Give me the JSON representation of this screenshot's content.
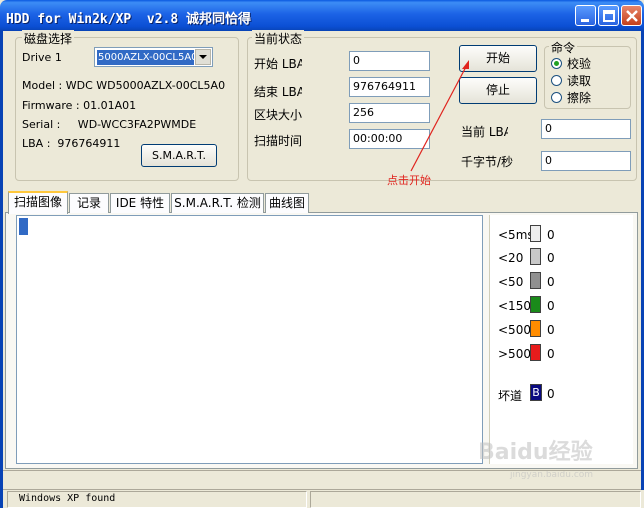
{
  "window": {
    "title": "HDD for Win2k/XP  v2.8 诚邦同恰得"
  },
  "disk_select": {
    "group_title": "磁盘选择",
    "drive_label": "Drive 1",
    "drive_selected": "5000AZLX-00CL5A0",
    "model": "Model : WDC WD5000AZLX-00CL5A0",
    "firmware": "Firmware : 01.01A01",
    "serial": "Serial :     WD-WCC3FA2PWMDE",
    "lba": "LBA :  976764911",
    "smart_button": "S.M.A.R.T."
  },
  "current_status": {
    "group_title": "当前状态",
    "start_lba_label": "开始 LBA",
    "start_lba_value": "0",
    "end_lba_label": "结束 LBA",
    "end_lba_value": "976764911",
    "block_size_label": "区块大小",
    "block_size_value": "256",
    "scan_time_label": "扫描时间",
    "scan_time_value": "00:00:00",
    "start_button": "开始",
    "stop_button": "停止",
    "current_lba_label": "当前 LBA",
    "current_lba_value": "0",
    "kb_per_sec_label": "千字节/秒",
    "kb_per_sec_value": "0"
  },
  "command": {
    "group_title": "命令",
    "options": [
      "校验",
      "读取",
      "擦除"
    ],
    "selected": "校验"
  },
  "annotation": {
    "text": "点击开始",
    "color": "#e0241e"
  },
  "tabs": [
    {
      "label": "扫描图像",
      "active": true
    },
    {
      "label": "记录",
      "active": false
    },
    {
      "label": "IDE 特性",
      "active": false
    },
    {
      "label": "S.M.A.R.T. 检测",
      "active": false
    },
    {
      "label": "曲线图",
      "active": false
    }
  ],
  "legend": {
    "items": [
      {
        "label": "<5ms",
        "count": "0",
        "color": "#eeeeee"
      },
      {
        "label": "<20",
        "count": "0",
        "color": "#c8c8c8"
      },
      {
        "label": "<50",
        "count": "0",
        "color": "#909090"
      },
      {
        "label": "<150",
        "count": "0",
        "color": "#1a8a1a"
      },
      {
        "label": "<500",
        "count": "0",
        "color": "#ff8c00"
      },
      {
        "label": ">500",
        "count": "0",
        "color": "#e81c1c"
      }
    ],
    "bad_label": "坏道",
    "bad_glyph": "B",
    "bad_count": "0",
    "bad_color": "#0a0a80"
  },
  "status_bar": {
    "text": "Windows XP found"
  },
  "watermark": {
    "text": "Baidu经验",
    "sub": "jingyan.baidu.com"
  }
}
